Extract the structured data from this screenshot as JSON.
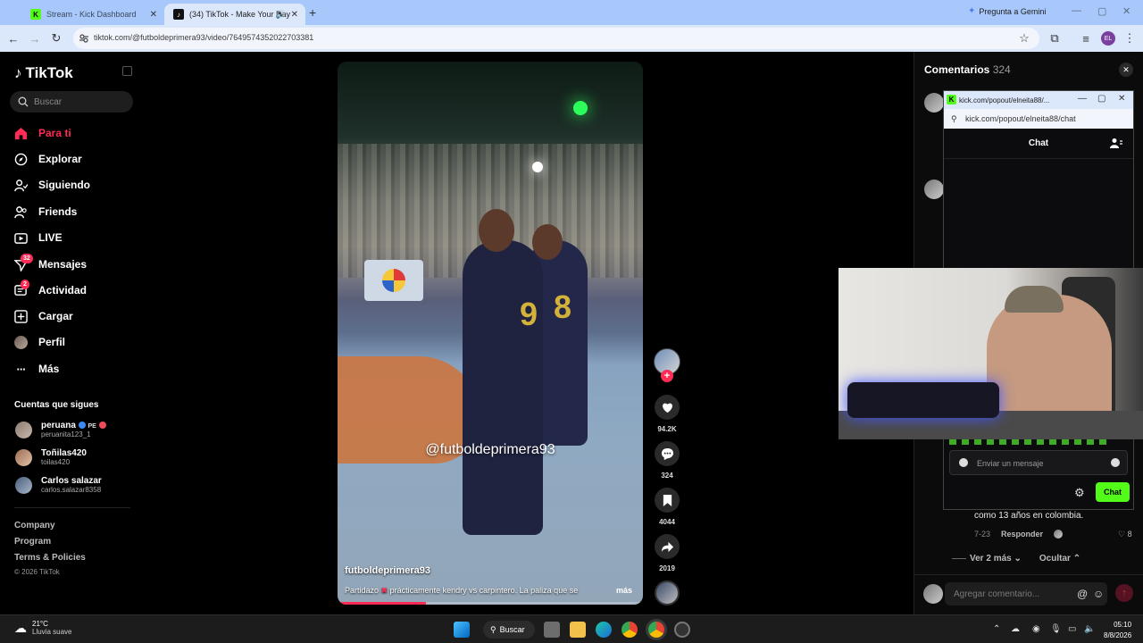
{
  "browser": {
    "tabs": [
      {
        "title": "Stream - Kick Dashboard",
        "active": false
      },
      {
        "title": "(34) TikTok - Make Your Day",
        "active": true
      }
    ],
    "gemini": "Pregunta a Gemini",
    "url": "tiktok.com/@futboldeprimera93/video/7649574352022703381",
    "profile_initials": "EL"
  },
  "sidebar": {
    "logo": "TikTok",
    "search_placeholder": "Buscar",
    "nav": [
      {
        "label": "Para ti",
        "icon": "home-icon",
        "active": true
      },
      {
        "label": "Explorar",
        "icon": "compass-icon"
      },
      {
        "label": "Siguiendo",
        "icon": "following-icon"
      },
      {
        "label": "Friends",
        "icon": "friends-icon"
      },
      {
        "label": "LIVE",
        "icon": "live-icon"
      },
      {
        "label": "Mensajes",
        "icon": "messages-icon",
        "badge": "32"
      },
      {
        "label": "Actividad",
        "icon": "activity-icon",
        "badge": "2"
      },
      {
        "label": "Cargar",
        "icon": "upload-icon"
      },
      {
        "label": "Perfil",
        "icon": "profile-icon"
      },
      {
        "label": "Más",
        "icon": "more-icon"
      }
    ],
    "following_heading": "Cuentas que sigues",
    "accounts": [
      {
        "name": "peruana",
        "handle": "peruanita123_1",
        "tag": "PE"
      },
      {
        "name": "Toñilas420",
        "handle": "toilas420"
      },
      {
        "name": "Carlos salazar",
        "handle": "carlos.salazar8358"
      }
    ],
    "footer": {
      "company": "Company",
      "program": "Program",
      "terms": "Terms & Policies",
      "copyright": "© 2026 TikTok"
    }
  },
  "video": {
    "watermark": "@futboldeprimera93",
    "author": "futboldeprimera93",
    "description_start": "Partidazo",
    "description_rest": "prácticamente kendry vs carpintero. La paliza que se",
    "more_label": "más",
    "progress": 0.29
  },
  "actions": {
    "likes": "94.2K",
    "comments": "324",
    "saves": "4044",
    "shares": "2019"
  },
  "comments": {
    "title": "Comentarios",
    "count": "324",
    "visible_comment": {
      "text": "como 13 años en colombia.",
      "date": "7-23",
      "reply_label": "Responder",
      "likes": "8"
    },
    "view_replies": "Ver 2 más",
    "hide_label": "Ocultar",
    "input_placeholder": "Agregar comentario..."
  },
  "kick_popout": {
    "window_title": "kick.com/popout/elneita88/...",
    "url": "kick.com/popout/elneita88/chat",
    "chat_title": "Chat",
    "input_placeholder": "Enviar un mensaje",
    "chat_button": "Chat"
  },
  "taskbar": {
    "temperature": "21°C",
    "weather": "Lluvia suave",
    "search_label": "Buscar",
    "time": "05:10",
    "date": "8/8/2026"
  }
}
